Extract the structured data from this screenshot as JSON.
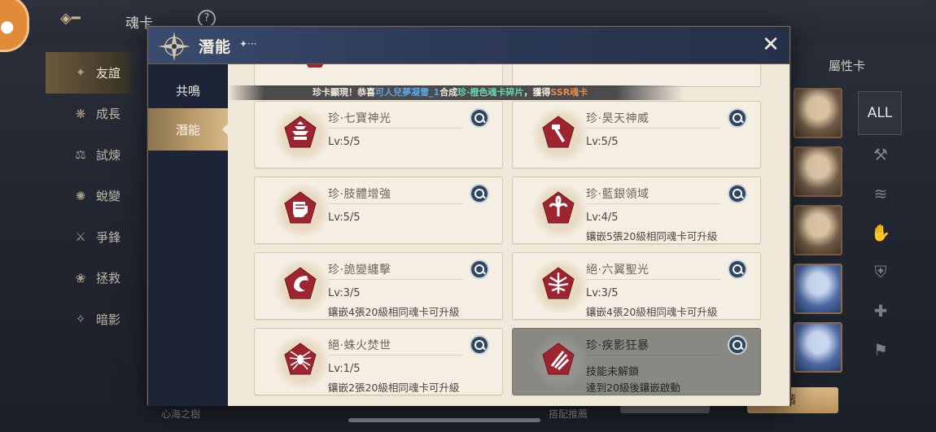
{
  "background": {
    "title": "魂卡",
    "help_icon": "question-icon",
    "sidebar": [
      {
        "label": "友誼",
        "icon": "sparkle-icon",
        "active": true
      },
      {
        "label": "成長",
        "icon": "sprout-icon"
      },
      {
        "label": "試煉",
        "icon": "scales-icon"
      },
      {
        "label": "蛻變",
        "icon": "swirl-icon"
      },
      {
        "label": "爭鋒",
        "icon": "sword-icon"
      },
      {
        "label": "拯救",
        "icon": "lotus-icon"
      },
      {
        "label": "暗影",
        "icon": "shadow-icon"
      }
    ],
    "right_tab": "屬性卡",
    "filter_all": "ALL",
    "bottom_left": "心海之樹",
    "bottom_mid": "搭配推薦",
    "bottom_button": "階"
  },
  "modal": {
    "title": "潛能",
    "subtitle": "✦···",
    "close_icon": "close-icon",
    "nav": [
      {
        "label": "共鳴",
        "active": false
      },
      {
        "label": "潛能",
        "active": true
      }
    ],
    "ticker": {
      "prefix": "珍卡顯現！恭喜",
      "player": "可人兒夢凝雪_1",
      "mid": "合成",
      "item": "珍·橙色魂卡碎片",
      "suffix": "，獲得",
      "reward": "SSR魂卡"
    },
    "cards": [
      {
        "name": "珍·七寶神光",
        "level": "Lv:5/5",
        "note": "",
        "icon": "pagoda-icon",
        "locked": false
      },
      {
        "name": "珍·昊天神威",
        "level": "Lv:5/5",
        "note": "",
        "icon": "hammer-icon",
        "locked": false
      },
      {
        "name": "珍·肢體增強",
        "level": "Lv:5/5",
        "note": "",
        "icon": "fist-icon",
        "locked": false
      },
      {
        "name": "珍·藍銀領域",
        "level": "Lv:4/5",
        "note": "鑲嵌5張20級相同魂卡可升級",
        "icon": "grass-icon",
        "locked": false
      },
      {
        "name": "珍·詭變纏擊",
        "level": "Lv:3/5",
        "note": "鑲嵌4張20級相同魂卡可升級",
        "icon": "crescent-icon",
        "locked": false
      },
      {
        "name": "絕·六翼聖光",
        "level": "Lv:3/5",
        "note": "鑲嵌4張20級相同魂卡可升級",
        "icon": "wings-icon",
        "locked": false
      },
      {
        "name": "絕·蛛火焚世",
        "level": "Lv:1/5",
        "note": "鑲嵌2張20級相同魂卡可升級",
        "icon": "spider-icon",
        "locked": false
      },
      {
        "name": "珍·疾影狂暴",
        "level": "技能未解鎖",
        "note": "達到20級後鑲嵌啟動",
        "icon": "claw-icon",
        "locked": true
      }
    ]
  }
}
